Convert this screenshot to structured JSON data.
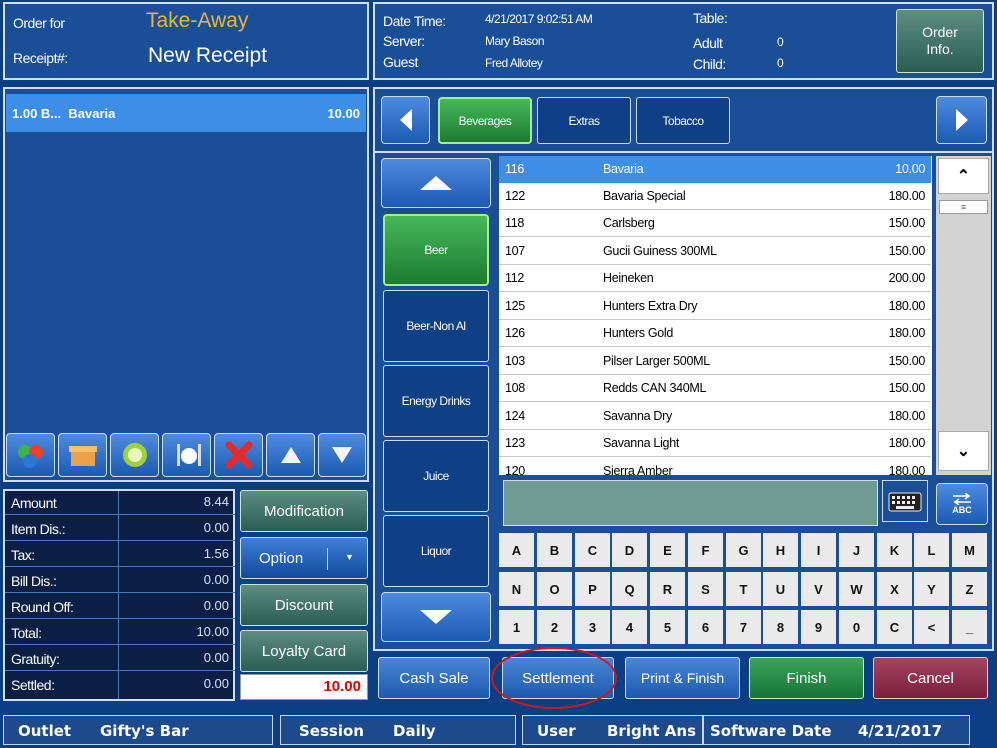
{
  "header": {
    "order_for_label": "Order for",
    "order_type": "Take-Away",
    "receipt_label": "Receipt#:",
    "receipt_value": "New Receipt",
    "datetime_label": "Date Time:",
    "datetime": "4/21/2017 9:02:51 AM",
    "server_label": "Server:",
    "server": "Mary Bason",
    "guest_label": "Guest",
    "guest": "Fred Allotey",
    "table_label": "Table:",
    "adult_label": "Adult",
    "adult": "0",
    "child_label": "Child:",
    "child": "0",
    "order_info_label": "Order Info."
  },
  "order_items": [
    {
      "text": "1.00 B...  Bavaria",
      "price": "10.00"
    }
  ],
  "summary": [
    {
      "label": "Amount",
      "value": "8.44"
    },
    {
      "label": "Item Dis.:",
      "value": "0.00"
    },
    {
      "label": "Tax:",
      "value": "1.56"
    },
    {
      "label": "Bill Dis.:",
      "value": "0.00"
    },
    {
      "label": "Round Off:",
      "value": "0.00"
    },
    {
      "label": "Total:",
      "value": "10.00"
    },
    {
      "label": "Gratuity:",
      "value": "0.00"
    },
    {
      "label": "Settled:",
      "value": "0.00"
    }
  ],
  "side_buttons": {
    "modification": "Modification",
    "option": "Option",
    "discount": "Discount",
    "loyalty": "Loyalty Card",
    "total_due": "10.00"
  },
  "tabs": [
    "Beverages",
    "Extras",
    "Tobacco"
  ],
  "categories": [
    "Beer",
    "Beer-Non Al",
    "Energy Drinks",
    "Juice",
    "Liquor"
  ],
  "products": [
    {
      "code": "116",
      "name": "Bavaria",
      "price": "10.00"
    },
    {
      "code": "122",
      "name": "Bavaria Special",
      "price": "180.00"
    },
    {
      "code": "118",
      "name": "Carlsberg",
      "price": "150.00"
    },
    {
      "code": "107",
      "name": "Gucii Guiness 300ML",
      "price": "150.00"
    },
    {
      "code": "112",
      "name": "Heineken",
      "price": "200.00"
    },
    {
      "code": "125",
      "name": "Hunters Extra Dry",
      "price": "180.00"
    },
    {
      "code": "126",
      "name": "Hunters Gold",
      "price": "180.00"
    },
    {
      "code": "103",
      "name": "Pilser Larger 500ML",
      "price": "150.00"
    },
    {
      "code": "108",
      "name": "Redds CAN 340ML",
      "price": "150.00"
    },
    {
      "code": "124",
      "name": "Savanna Dry",
      "price": "180.00"
    },
    {
      "code": "123",
      "name": "Savanna Light",
      "price": "180.00"
    },
    {
      "code": "120",
      "name": "Sierra Amber",
      "price": "180.00"
    }
  ],
  "keyboard": [
    [
      "A",
      "B",
      "C",
      "D",
      "E",
      "F",
      "G",
      "H",
      "I",
      "J",
      "K",
      "L",
      "M"
    ],
    [
      "N",
      "O",
      "P",
      "Q",
      "R",
      "S",
      "T",
      "U",
      "V",
      "W",
      "X",
      "Y",
      "Z"
    ],
    [
      "1",
      "2",
      "3",
      "4",
      "5",
      "6",
      "7",
      "8",
      "9",
      "0",
      "C",
      "<",
      "_"
    ]
  ],
  "abc_label": "ABC",
  "actions": {
    "cash_sale": "Cash Sale",
    "settlement": "Settlement",
    "print_finish": "Print & Finish",
    "finish": "Finish",
    "cancel": "Cancel"
  },
  "status": {
    "outlet_label": "Outlet",
    "outlet": "Gifty's Bar",
    "session_label": "Session",
    "session": "Daily",
    "user_label": "User",
    "user": "Bright Ans",
    "software_date_label": "Software Date",
    "software_date": "4/21/2017"
  },
  "colors": {
    "background": "#0c3e84",
    "selected": "#3d8ee6",
    "accent_green": "#2d9a44",
    "cancel": "#8a2d4a",
    "highlight_circle": "#d0161b",
    "order_type": "#f0b040"
  }
}
